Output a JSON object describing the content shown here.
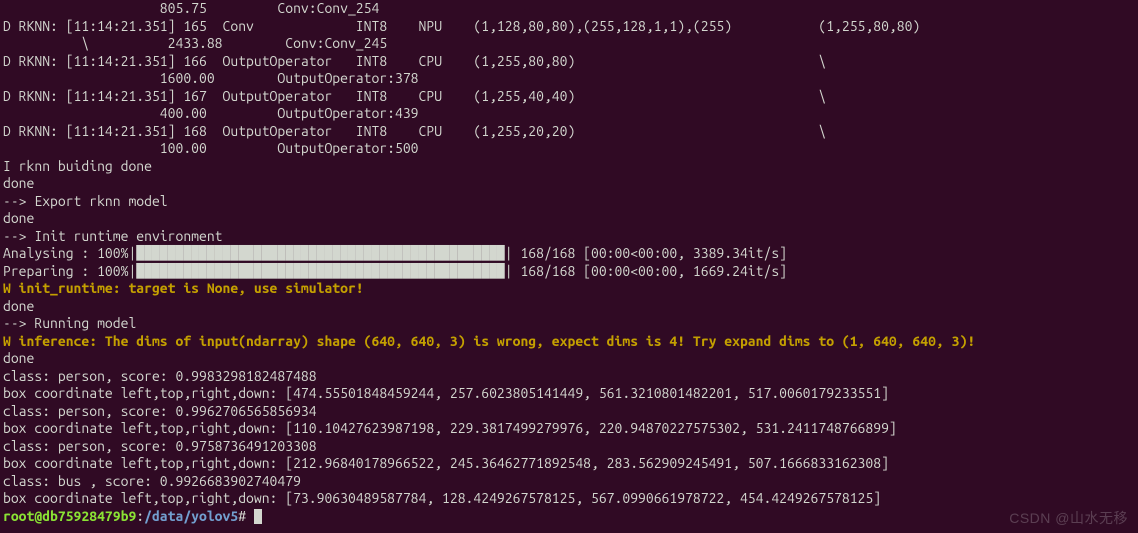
{
  "watermark": "CSDN @山水无移",
  "prompt": {
    "user": "root@db75928479b9",
    "path": "/data/yolov5",
    "suffix": "#"
  },
  "lines": [
    {
      "cls": "",
      "text": "                    805.75         Conv:Conv_254"
    },
    {
      "cls": "",
      "text": "D RKNN: [11:14:21.351] 165  Conv             INT8    NPU    (1,128,80,80),(255,128,1,1),(255)           (1,255,80,80)"
    },
    {
      "cls": "",
      "text": "          \\          2433.88        Conv:Conv_245"
    },
    {
      "cls": "",
      "text": "D RKNN: [11:14:21.351] 166  OutputOperator   INT8    CPU    (1,255,80,80)                               \\"
    },
    {
      "cls": "",
      "text": "                    1600.00        OutputOperator:378"
    },
    {
      "cls": "",
      "text": "D RKNN: [11:14:21.351] 167  OutputOperator   INT8    CPU    (1,255,40,40)                               \\"
    },
    {
      "cls": "",
      "text": "                    400.00         OutputOperator:439"
    },
    {
      "cls": "",
      "text": "D RKNN: [11:14:21.351] 168  OutputOperator   INT8    CPU    (1,255,20,20)                               \\"
    },
    {
      "cls": "",
      "text": "                    100.00         OutputOperator:500"
    },
    {
      "cls": "",
      "text": "I rknn buiding done"
    },
    {
      "cls": "",
      "text": "done"
    },
    {
      "cls": "",
      "text": "--> Export rknn model"
    },
    {
      "cls": "",
      "text": "done"
    },
    {
      "cls": "",
      "text": "--> Init runtime environment"
    },
    {
      "cls": "",
      "text": "Analysing : 100%|███████████████████████████████████████████████| 168/168 [00:00<00:00, 3389.34it/s]"
    },
    {
      "cls": "",
      "text": "Preparing : 100%|███████████████████████████████████████████████| 168/168 [00:00<00:00, 1669.24it/s]"
    },
    {
      "cls": "warn",
      "text": "W init_runtime: target is None, use simulator!"
    },
    {
      "cls": "",
      "text": "done"
    },
    {
      "cls": "",
      "text": "--> Running model"
    },
    {
      "cls": "warn",
      "text": "W inference: The dims of input(ndarray) shape (640, 640, 3) is wrong, expect dims is 4! Try expand dims to (1, 640, 640, 3)!"
    },
    {
      "cls": "",
      "text": "done"
    },
    {
      "cls": "",
      "text": "class: person, score: 0.9983298182487488"
    },
    {
      "cls": "",
      "text": "box coordinate left,top,right,down: [474.55501848459244, 257.6023805141449, 561.3210801482201, 517.0060179233551]"
    },
    {
      "cls": "",
      "text": "class: person, score: 0.9962706565856934"
    },
    {
      "cls": "",
      "text": "box coordinate left,top,right,down: [110.10427623987198, 229.3817499279976, 220.94870227575302, 531.2411748766899]"
    },
    {
      "cls": "",
      "text": "class: person, score: 0.9758736491203308"
    },
    {
      "cls": "",
      "text": "box coordinate left,top,right,down: [212.96840178966522, 245.36462771892548, 283.562909245491, 507.1666833162308]"
    },
    {
      "cls": "",
      "text": "class: bus , score: 0.9926683902740479"
    },
    {
      "cls": "",
      "text": "box coordinate left,top,right,down: [73.90630489587784, 128.4249267578125, 567.0990661978722, 454.4249267578125]"
    }
  ]
}
